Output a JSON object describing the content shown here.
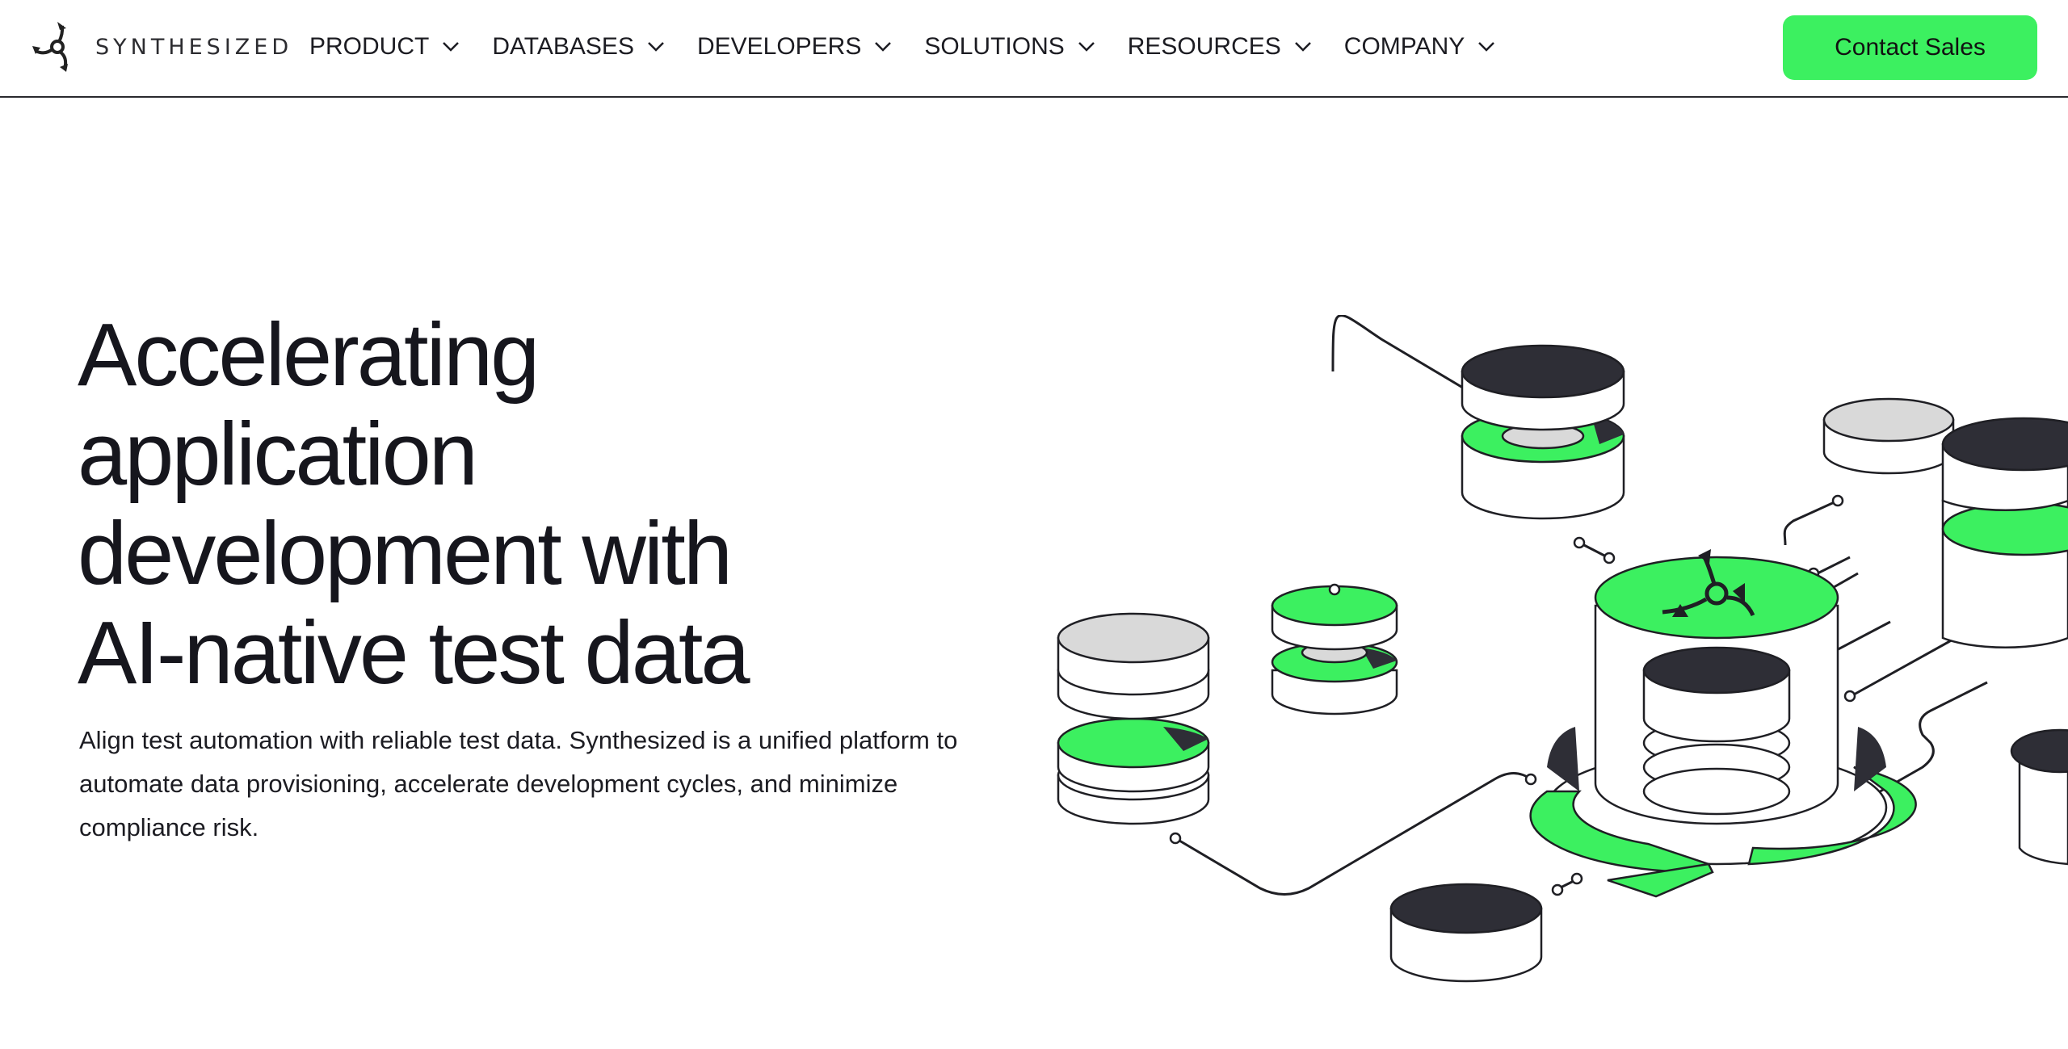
{
  "brand": {
    "name": "SYNTHESIZED"
  },
  "nav": {
    "items": [
      {
        "label": "PRODUCT"
      },
      {
        "label": "DATABASES"
      },
      {
        "label": "DEVELOPERS"
      },
      {
        "label": "SOLUTIONS"
      },
      {
        "label": "RESOURCES"
      },
      {
        "label": "COMPANY"
      }
    ],
    "cta_label": "Contact Sales"
  },
  "hero": {
    "title_lines": [
      "Accelerating",
      "application",
      "development with",
      "AI-native test data"
    ],
    "description": "Align test automation with reliable test data. Synthesized is a unified platform to automate data provisioning, accelerate development cycles, and minimize compliance risk."
  },
  "colors": {
    "accent": "#3cf060",
    "dark": "#2e2e36",
    "light_gray": "#d9d9d9",
    "text": "#16161d"
  }
}
